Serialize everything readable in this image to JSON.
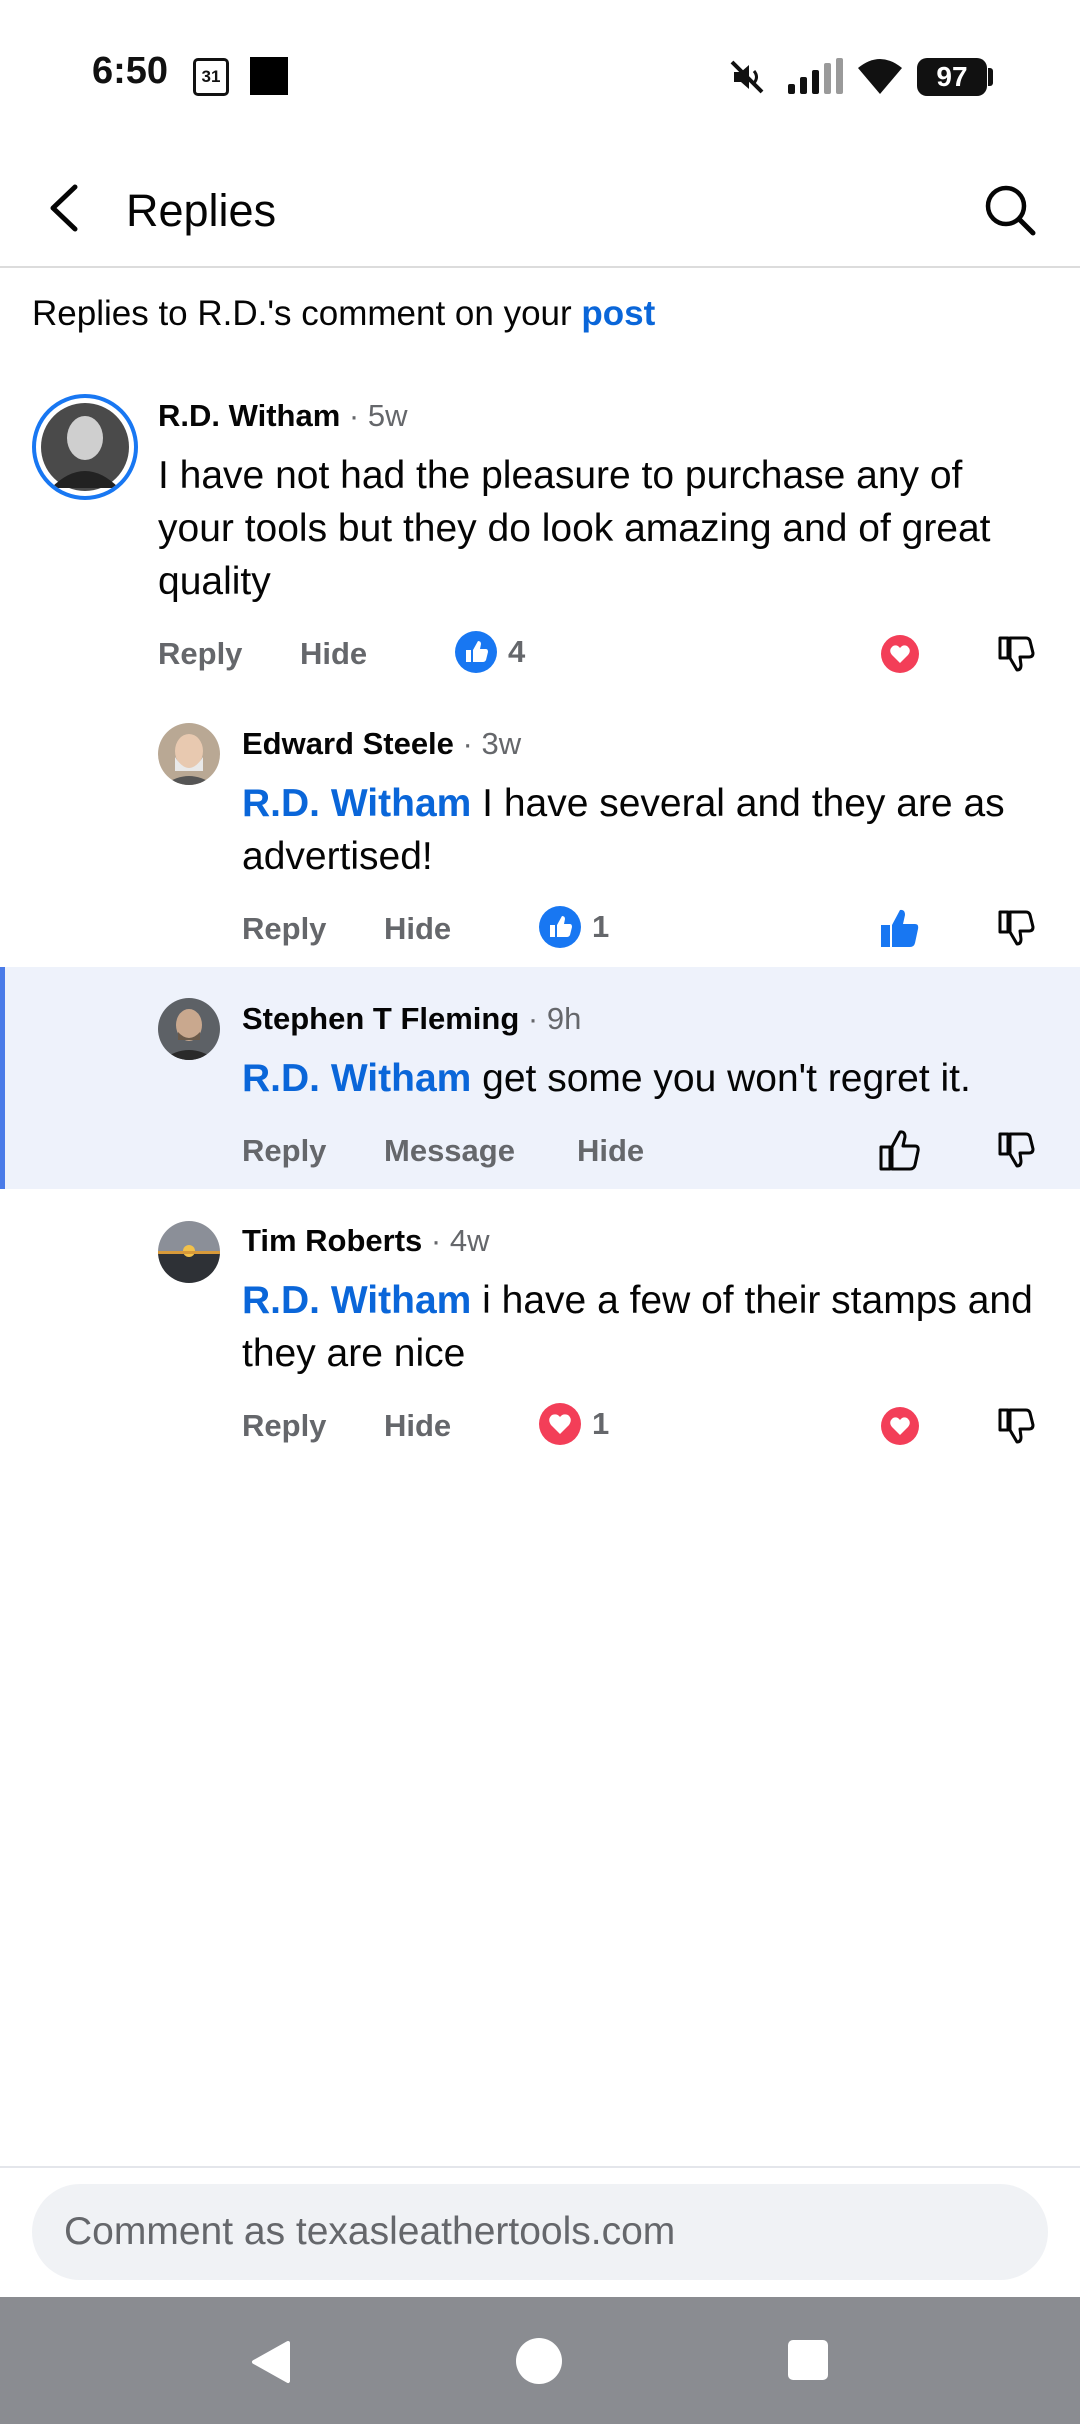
{
  "status_bar": {
    "time": "6:50",
    "calendar_day": "31",
    "battery": "97"
  },
  "header": {
    "title": "Replies"
  },
  "context": {
    "prefix": "Replies to R.D.'s comment on your ",
    "link": "post"
  },
  "comments": [
    {
      "name": "R.D. Witham",
      "time": "· 5w",
      "mention": "",
      "text": "I have not had the pleasure to purchase any of your tools but they do look amazing and of great quality",
      "actions": [
        "Reply",
        "Hide"
      ],
      "reaction_count": "4"
    },
    {
      "name": "Edward Steele",
      "time": "· 3w",
      "mention": "R.D. Witham",
      "text": " I have several and they are as advertised!",
      "actions": [
        "Reply",
        "Hide"
      ],
      "reaction_count": "1"
    },
    {
      "name": "Stephen T Fleming",
      "time": "· 9h",
      "mention": "R.D. Witham",
      "text": " get some you won't regret it.",
      "actions": [
        "Reply",
        "Message",
        "Hide"
      ],
      "reaction_count": ""
    },
    {
      "name": "Tim Roberts",
      "time": "· 4w",
      "mention": "R.D. Witham",
      "text": " i have a few of their stamps and they are nice",
      "actions": [
        "Reply",
        "Hide"
      ],
      "reaction_count": "1"
    }
  ],
  "composer": {
    "placeholder": "Comment as texasleathertools.com"
  },
  "colors": {
    "accent": "#0a66d9",
    "love": "#f33e58",
    "like": "#1877f2",
    "highlight": "#eef2fb"
  }
}
